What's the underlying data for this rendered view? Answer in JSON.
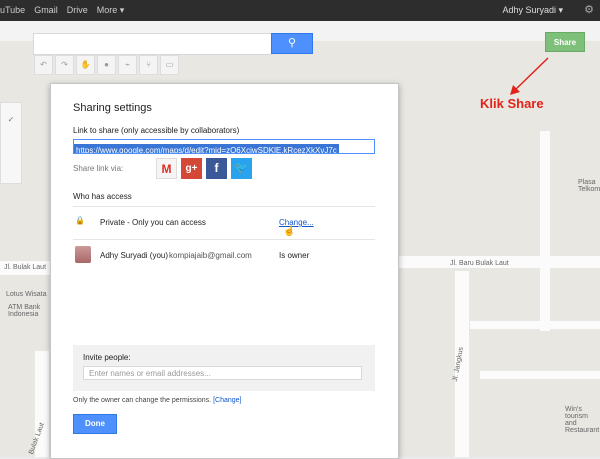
{
  "topbar": {
    "nav": [
      "uTube",
      "Gmail",
      "Drive",
      "More ▾"
    ],
    "user": "Adhy Suryadi ▾"
  },
  "map": {
    "labels": [
      "Jl. Baru Bulak Laut",
      "Jl. Bulak Laut",
      "Lotus Wisata",
      "ATM Bank Indonesia",
      "Plasa Telkom",
      "Jl. Jangkus",
      "Win's tourism and Restaurant",
      "Bulak Laut"
    ]
  },
  "share_button": "Share",
  "annotation": "Klik Share",
  "dialog": {
    "title": "Sharing settings",
    "link_label": "Link to share (only accessible by collaborators)",
    "link_value": "https://www.google.com/maps/d/edit?mid=zQ6XcjwSDKlE.kRcezXkXvJ7c",
    "share_via": "Share link via:",
    "social": [
      "gmail-icon",
      "google-plus-icon",
      "facebook-icon",
      "twitter-icon"
    ],
    "who_has_access": "Who has access",
    "access_row": {
      "label": "Private - Only you can access",
      "action": "Change..."
    },
    "owner_row": {
      "name": "Adhy Suryadi (you)",
      "email": "kompiajaib@gmail.com",
      "role": "Is owner"
    },
    "invite_label": "Invite people:",
    "invite_placeholder": "Enter names or email addresses...",
    "owner_note": "Only the owner can change the permissions.",
    "owner_note_link": "[Change]",
    "done": "Done"
  }
}
